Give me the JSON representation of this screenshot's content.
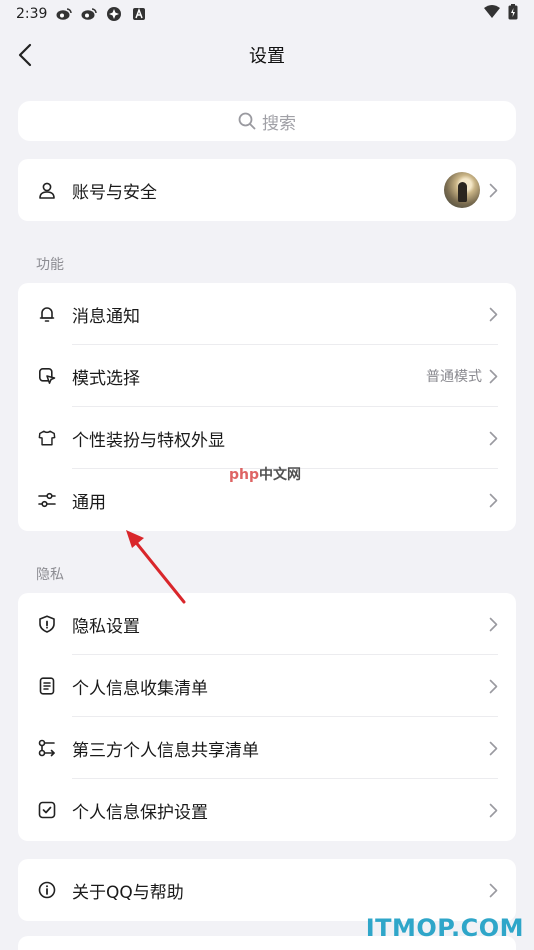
{
  "status_bar": {
    "time": "2:39"
  },
  "nav": {
    "title": "设置"
  },
  "search": {
    "placeholder": "搜索"
  },
  "account": {
    "label": "账号与安全"
  },
  "sections": {
    "features_title": "功能",
    "privacy_title": "隐私"
  },
  "features": [
    {
      "label": "消息通知",
      "icon": "bell-icon"
    },
    {
      "label": "模式选择",
      "icon": "mode-icon",
      "value": "普通模式"
    },
    {
      "label": "个性装扮与特权外显",
      "icon": "shirt-icon"
    },
    {
      "label": "通用",
      "icon": "sliders-icon"
    }
  ],
  "privacy": [
    {
      "label": "隐私设置",
      "icon": "shield-icon"
    },
    {
      "label": "个人信息收集清单",
      "icon": "document-icon"
    },
    {
      "label": "第三方个人信息共享清单",
      "icon": "share-icon"
    },
    {
      "label": "个人信息保护设置",
      "icon": "checkbox-icon"
    }
  ],
  "about": {
    "label": "关于QQ与帮助"
  },
  "watermarks": {
    "php_en": "php",
    "php_cn": "中文网",
    "itmop": "ITMOP.COM"
  },
  "colors": {
    "background": "#f2f2f6",
    "card": "#ffffff",
    "arrow": "#d9262b",
    "itmop": "#2fa6c9"
  }
}
